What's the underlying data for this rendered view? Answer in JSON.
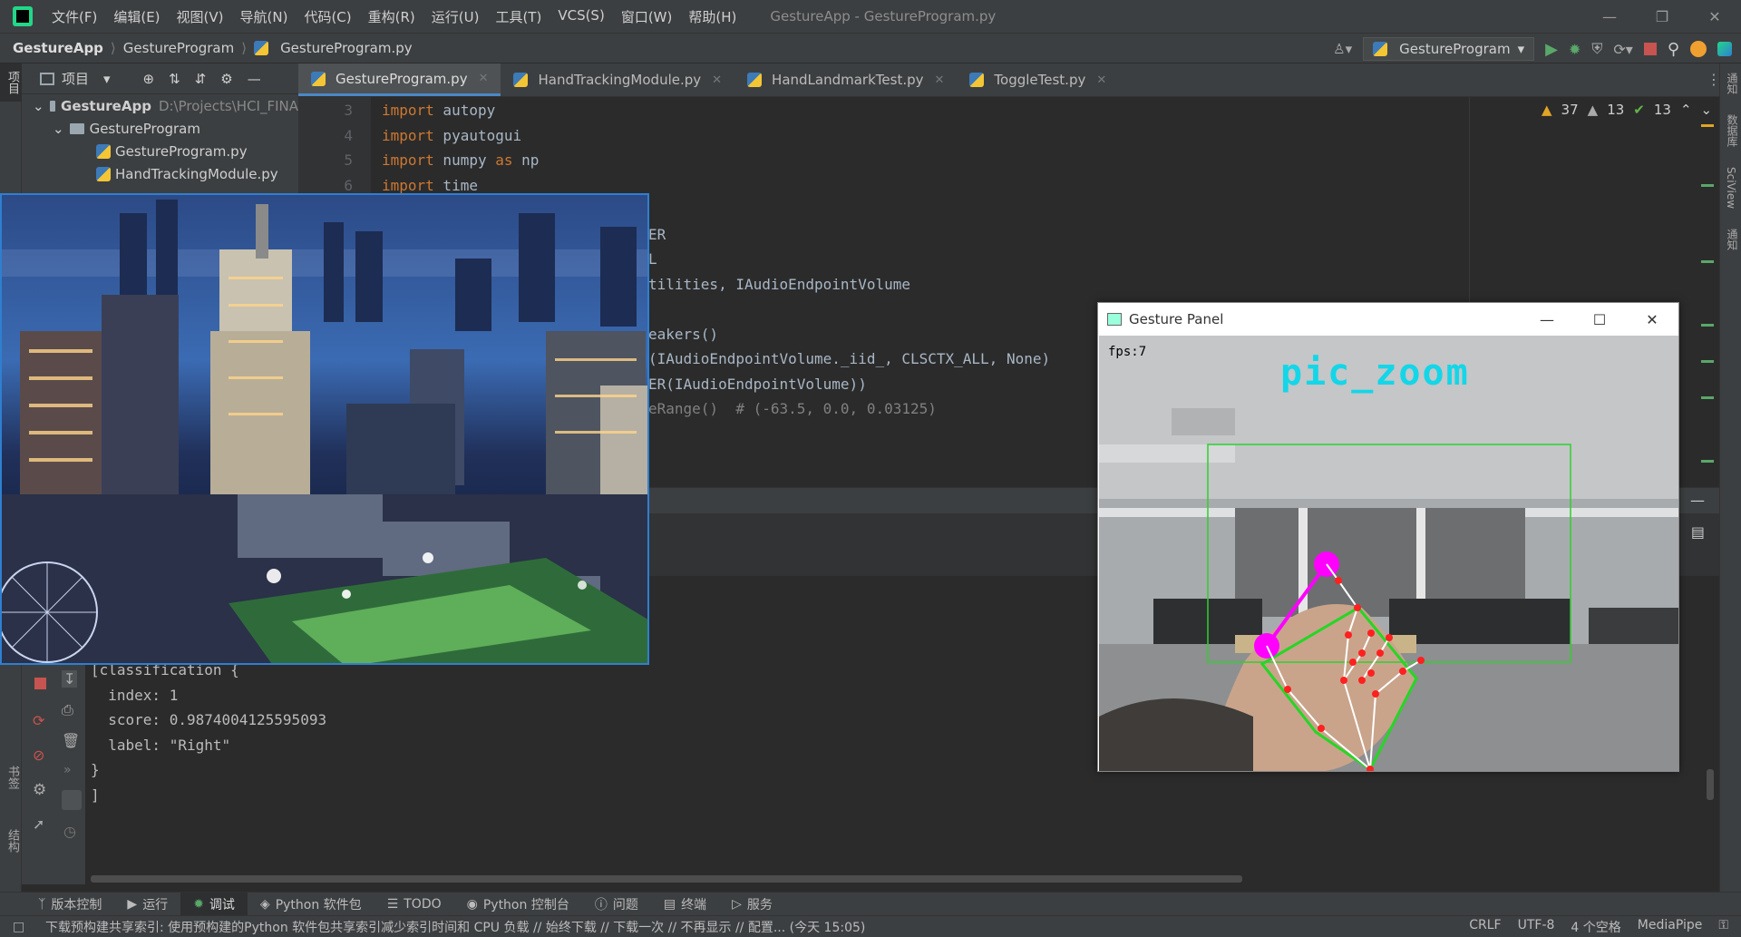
{
  "titlebar": {
    "menu": [
      "文件(F)",
      "编辑(E)",
      "视图(V)",
      "导航(N)",
      "代码(C)",
      "重构(R)",
      "运行(U)",
      "工具(T)",
      "VCS(S)",
      "窗口(W)",
      "帮助(H)"
    ],
    "window_title": "GestureApp - GestureProgram.py"
  },
  "navbar": {
    "project": "GestureApp",
    "folder": "GestureProgram",
    "file": "GestureProgram.py",
    "run_config": "GestureProgram"
  },
  "project_panel": {
    "title": "项目",
    "root_name": "GestureApp",
    "root_path": "D:\\Projects\\HCI_FINA",
    "folder": "GestureProgram",
    "files": [
      "GestureProgram.py",
      "HandTrackingModule.py"
    ]
  },
  "tabs": [
    "GestureProgram.py",
    "HandTrackingModule.py",
    "HandLandmarkTest.py",
    "ToggleTest.py"
  ],
  "editor": {
    "line_numbers": [
      "3",
      "4",
      "5",
      "6"
    ],
    "lines": [
      {
        "kw": "import",
        "rest": " autopy"
      },
      {
        "kw": "import",
        "rest": " pyautogui"
      },
      {
        "kw": "import",
        "rest": " numpy ",
        "kw2": "as",
        "rest2": " np"
      },
      {
        "kw": "import",
        "rest": " time"
      }
    ],
    "visible_fragments": [
      "ER",
      "L",
      "tilities, IAudioEndpointVolume",
      "eakers()",
      "(IAudioEndpointVolume._iid_, CLSCTX_ALL, None)",
      "ER(IAudioEndpointVolume))",
      "eRange()  # (-63.5, 0.0, 0.03125)"
    ]
  },
  "inspections": {
    "warnings": "37",
    "weak_warnings": "13",
    "ok": "13"
  },
  "console": {
    "lines": [
      "[classification {",
      "  index: 1",
      "  score: 0.9874004125595093",
      "  label: \"Right\"",
      "}",
      "]"
    ]
  },
  "bottom_tabs": [
    "版本控制",
    "运行",
    "调试",
    "Python 软件包",
    "TODO",
    "Python 控制台",
    "问题",
    "终端",
    "服务"
  ],
  "bottom_tabs_active": "调试",
  "statusbar": {
    "message": "下载预构建共享索引: 使用预构建的Python 软件包共享索引减少索引时间和 CPU 负载 // 始终下载 // 下载一次 // 不再显示 // 配置... (今天 15:05)",
    "line_sep": "CRLF",
    "encoding": "UTF-8",
    "indent": "4 个空格",
    "interpreter": "MediaPipe"
  },
  "side_labels": {
    "left_top": "项目",
    "left_bottom1": "书签",
    "left_bottom2": "结构",
    "right1": "通知",
    "right2": "数据库",
    "right3": "SciView",
    "right4": "通知"
  },
  "gesture_panel": {
    "title": "Gesture Panel",
    "fps": "fps:7",
    "mode": "pic_zoom"
  }
}
